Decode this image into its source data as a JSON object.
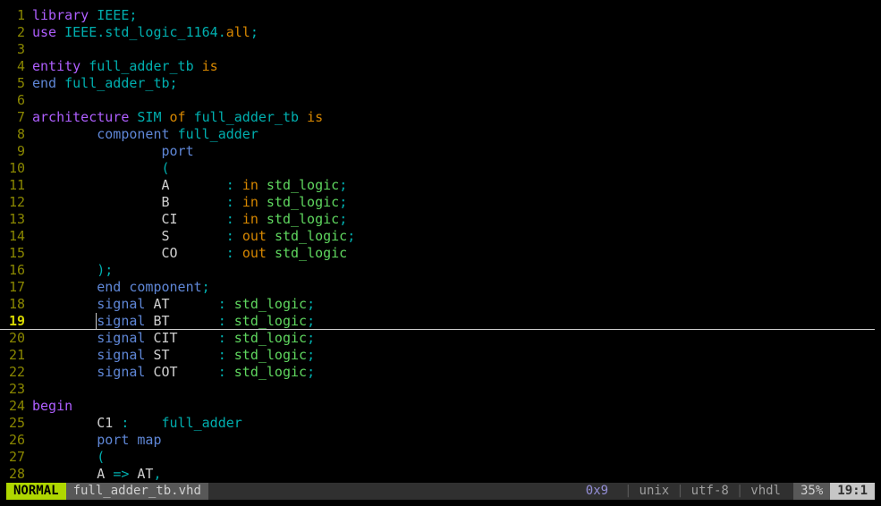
{
  "statusbar": {
    "mode": "NORMAL",
    "filename": "full_adder_tb.vhd",
    "hex": "0x9",
    "fileformat": "unix",
    "encoding": "utf-8",
    "filetype": "vhdl",
    "percent": "35%",
    "position": "19:1"
  },
  "cursor_line": 19,
  "lines": [
    {
      "n": 1,
      "tokens": [
        [
          "kw",
          "library"
        ],
        [
          "id",
          " "
        ],
        [
          "fn",
          "IEEE"
        ],
        [
          "semi",
          ";"
        ]
      ]
    },
    {
      "n": 2,
      "tokens": [
        [
          "use",
          "use"
        ],
        [
          "id",
          " "
        ],
        [
          "fn",
          "IEEE"
        ],
        [
          "dot",
          "."
        ],
        [
          "fn",
          "std_logic_1164"
        ],
        [
          "dot",
          "."
        ],
        [
          "all",
          "all"
        ],
        [
          "semi",
          ";"
        ]
      ]
    },
    {
      "n": 3,
      "tokens": []
    },
    {
      "n": 4,
      "tokens": [
        [
          "kw",
          "entity"
        ],
        [
          "id",
          " "
        ],
        [
          "fn",
          "full_adder_tb"
        ],
        [
          "id",
          " "
        ],
        [
          "io",
          "is"
        ]
      ]
    },
    {
      "n": 5,
      "tokens": [
        [
          "kw2",
          "end"
        ],
        [
          "id",
          " "
        ],
        [
          "fn",
          "full_adder_tb"
        ],
        [
          "semi",
          ";"
        ]
      ]
    },
    {
      "n": 6,
      "tokens": []
    },
    {
      "n": 7,
      "tokens": [
        [
          "kw",
          "architecture"
        ],
        [
          "id",
          " "
        ],
        [
          "fn",
          "SIM"
        ],
        [
          "id",
          " "
        ],
        [
          "of",
          "of"
        ],
        [
          "id",
          " "
        ],
        [
          "fn",
          "full_adder_tb"
        ],
        [
          "id",
          " "
        ],
        [
          "io",
          "is"
        ]
      ]
    },
    {
      "n": 8,
      "tokens": [
        [
          "id",
          "        "
        ],
        [
          "kw2",
          "component"
        ],
        [
          "id",
          " "
        ],
        [
          "fn",
          "full_adder"
        ]
      ]
    },
    {
      "n": 9,
      "tokens": [
        [
          "id",
          "                "
        ],
        [
          "kw2",
          "port"
        ]
      ]
    },
    {
      "n": 10,
      "tokens": [
        [
          "id",
          "                "
        ],
        [
          "pun",
          "("
        ]
      ]
    },
    {
      "n": 11,
      "tokens": [
        [
          "id",
          "                "
        ],
        [
          "id",
          "A       "
        ],
        [
          "pun",
          ":"
        ],
        [
          "id",
          " "
        ],
        [
          "io",
          "in"
        ],
        [
          "id",
          " "
        ],
        [
          "ty",
          "std_logic"
        ],
        [
          "semi",
          ";"
        ]
      ]
    },
    {
      "n": 12,
      "tokens": [
        [
          "id",
          "                "
        ],
        [
          "id",
          "B       "
        ],
        [
          "pun",
          ":"
        ],
        [
          "id",
          " "
        ],
        [
          "io",
          "in"
        ],
        [
          "id",
          " "
        ],
        [
          "ty",
          "std_logic"
        ],
        [
          "semi",
          ";"
        ]
      ]
    },
    {
      "n": 13,
      "tokens": [
        [
          "id",
          "                "
        ],
        [
          "id",
          "CI      "
        ],
        [
          "pun",
          ":"
        ],
        [
          "id",
          " "
        ],
        [
          "io",
          "in"
        ],
        [
          "id",
          " "
        ],
        [
          "ty",
          "std_logic"
        ],
        [
          "semi",
          ";"
        ]
      ]
    },
    {
      "n": 14,
      "tokens": [
        [
          "id",
          "                "
        ],
        [
          "id",
          "S       "
        ],
        [
          "pun",
          ":"
        ],
        [
          "id",
          " "
        ],
        [
          "io",
          "out"
        ],
        [
          "id",
          " "
        ],
        [
          "ty",
          "std_logic"
        ],
        [
          "semi",
          ";"
        ]
      ]
    },
    {
      "n": 15,
      "tokens": [
        [
          "id",
          "                "
        ],
        [
          "id",
          "CO      "
        ],
        [
          "pun",
          ":"
        ],
        [
          "id",
          " "
        ],
        [
          "io",
          "out"
        ],
        [
          "id",
          " "
        ],
        [
          "ty",
          "std_logic"
        ]
      ]
    },
    {
      "n": 16,
      "tokens": [
        [
          "id",
          "        "
        ],
        [
          "pun",
          ")"
        ],
        [
          "semi",
          ";"
        ]
      ]
    },
    {
      "n": 17,
      "tokens": [
        [
          "id",
          "        "
        ],
        [
          "kw2",
          "end"
        ],
        [
          "id",
          " "
        ],
        [
          "kw2",
          "component"
        ],
        [
          "semi",
          ";"
        ]
      ]
    },
    {
      "n": 18,
      "tokens": [
        [
          "id",
          "        "
        ],
        [
          "kw2",
          "signal"
        ],
        [
          "id",
          " "
        ],
        [
          "id",
          "AT      "
        ],
        [
          "pun",
          ":"
        ],
        [
          "id",
          " "
        ],
        [
          "ty",
          "std_logic"
        ],
        [
          "semi",
          ";"
        ]
      ]
    },
    {
      "n": 19,
      "tokens": [
        [
          "id",
          "        "
        ],
        [
          "kw2",
          "signal"
        ],
        [
          "id",
          " "
        ],
        [
          "id",
          "BT      "
        ],
        [
          "pun",
          ":"
        ],
        [
          "id",
          " "
        ],
        [
          "ty",
          "std_logic"
        ],
        [
          "semi",
          ";"
        ]
      ]
    },
    {
      "n": 20,
      "tokens": [
        [
          "id",
          "        "
        ],
        [
          "kw2",
          "signal"
        ],
        [
          "id",
          " "
        ],
        [
          "id",
          "CIT     "
        ],
        [
          "pun",
          ":"
        ],
        [
          "id",
          " "
        ],
        [
          "ty",
          "std_logic"
        ],
        [
          "semi",
          ";"
        ]
      ]
    },
    {
      "n": 21,
      "tokens": [
        [
          "id",
          "        "
        ],
        [
          "kw2",
          "signal"
        ],
        [
          "id",
          " "
        ],
        [
          "id",
          "ST      "
        ],
        [
          "pun",
          ":"
        ],
        [
          "id",
          " "
        ],
        [
          "ty",
          "std_logic"
        ],
        [
          "semi",
          ";"
        ]
      ]
    },
    {
      "n": 22,
      "tokens": [
        [
          "id",
          "        "
        ],
        [
          "kw2",
          "signal"
        ],
        [
          "id",
          " "
        ],
        [
          "id",
          "COT     "
        ],
        [
          "pun",
          ":"
        ],
        [
          "id",
          " "
        ],
        [
          "ty",
          "std_logic"
        ],
        [
          "semi",
          ";"
        ]
      ]
    },
    {
      "n": 23,
      "tokens": []
    },
    {
      "n": 24,
      "tokens": [
        [
          "kw",
          "begin"
        ]
      ]
    },
    {
      "n": 25,
      "tokens": [
        [
          "id",
          "        "
        ],
        [
          "id",
          "C1 "
        ],
        [
          "pun",
          ":"
        ],
        [
          "id",
          "    "
        ],
        [
          "fn",
          "full_adder"
        ]
      ]
    },
    {
      "n": 26,
      "tokens": [
        [
          "id",
          "        "
        ],
        [
          "kw2",
          "port"
        ],
        [
          "id",
          " "
        ],
        [
          "kw2",
          "map"
        ]
      ]
    },
    {
      "n": 27,
      "tokens": [
        [
          "id",
          "        "
        ],
        [
          "pun",
          "("
        ]
      ]
    },
    {
      "n": 28,
      "tokens": [
        [
          "id",
          "        "
        ],
        [
          "id",
          "A "
        ],
        [
          "arrow",
          "=>"
        ],
        [
          "id",
          " "
        ],
        [
          "id",
          "AT"
        ],
        [
          "comma",
          ","
        ]
      ]
    }
  ]
}
